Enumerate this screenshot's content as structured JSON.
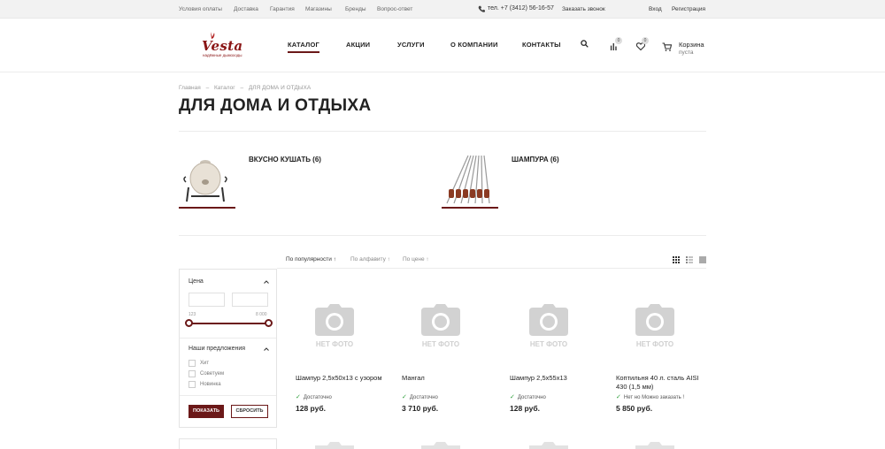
{
  "topbar": {
    "links": [
      "Условия оплаты",
      "Доставка",
      "Гарантия",
      "Магазины",
      "Бренды",
      "Вопрос-ответ"
    ],
    "phone": "тел. +7 (3412) 56-16-57",
    "callback": "Заказать звонок",
    "login": "Вход",
    "register": "Регистрация"
  },
  "logo": {
    "text": "Vesta",
    "tagline": "надёжные дымоходы"
  },
  "nav": [
    "КАТАЛОГ",
    "АКЦИИ",
    "УСЛУГИ",
    "О КОМПАНИИ",
    "КОНТАКТЫ"
  ],
  "header": {
    "compare_count": "0",
    "favorites_count": "0",
    "cart_label": "Корзина",
    "cart_status": "пуста"
  },
  "breadcrumbs": [
    "Главная",
    "–",
    "Каталог",
    "–",
    "ДЛЯ ДОМА И ОТДЫХА"
  ],
  "page_title": "ДЛЯ ДОМА И ОТДЫХА",
  "categories": [
    {
      "title": "ВКУСНО КУШАТЬ (6)"
    },
    {
      "title": "ШАМПУРА (6)"
    }
  ],
  "sort": {
    "options": [
      "По популярности ↑",
      "По алфавиту ↑",
      "По цене ↑"
    ],
    "active": 0
  },
  "filter": {
    "price_title": "Цена",
    "price_min_placeholder": "",
    "price_max_placeholder": "",
    "range_min": "123",
    "range_max": "8 000",
    "offers_title": "Наши предложения",
    "offers": [
      "Хит",
      "Советуем",
      "Новинка"
    ],
    "show_button": "ПОКАЗАТЬ",
    "reset_button": "СБРОСИТЬ"
  },
  "products": [
    {
      "no_photo": "НЕТ ФОТО",
      "name": "Шампур 2,5х50х13 с узором",
      "stock": "Достаточно",
      "price": "128 руб."
    },
    {
      "no_photo": "НЕТ ФОТО",
      "name": "Мангал",
      "stock": "Достаточно",
      "price": "3 710 руб."
    },
    {
      "no_photo": "НЕТ ФОТО",
      "name": "Шампур 2,5х55х13",
      "stock": "Достаточно",
      "price": "128 руб."
    },
    {
      "no_photo": "НЕТ ФОТО",
      "name": "Коптильня 40 л. сталь AISI 430 (1,5 мм)",
      "stock": "Нет но Можно заказать !",
      "price": "5 850 руб."
    }
  ],
  "colors": {
    "accent": "#6b1818",
    "in_stock": "#2e9e3a",
    "placeholder": "#cfcfcf"
  },
  "icons": [
    "search-icon",
    "compare-icon",
    "heart-icon",
    "cart-icon",
    "phone-icon",
    "camera-icon",
    "grid-view-icon",
    "list-view-icon",
    "table-view-icon",
    "chevron-up-icon",
    "check-icon"
  ]
}
